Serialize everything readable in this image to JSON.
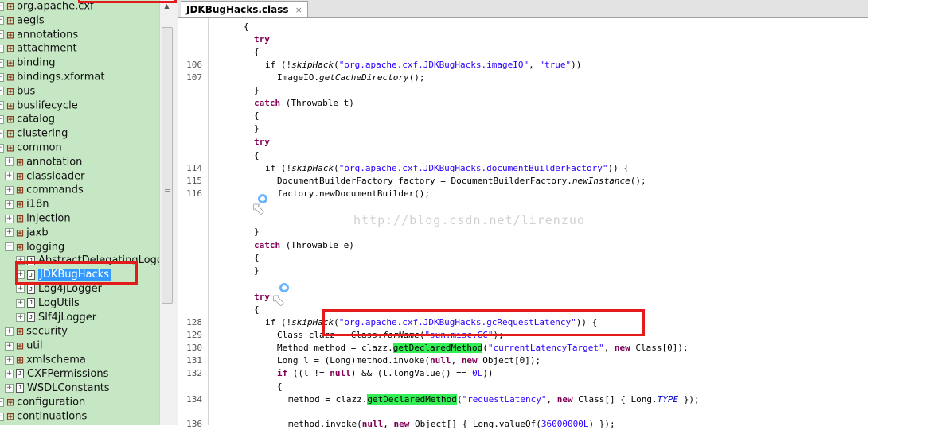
{
  "tree": {
    "items": [
      {
        "label": "org.apache.cxf",
        "kind": "package",
        "expander": "−",
        "level": 0
      },
      {
        "label": "aegis",
        "kind": "package",
        "expander": "+",
        "level": 0
      },
      {
        "label": "annotations",
        "kind": "package",
        "expander": "+",
        "level": 0
      },
      {
        "label": "attachment",
        "kind": "package",
        "expander": "+",
        "level": 0
      },
      {
        "label": "binding",
        "kind": "package",
        "expander": "+",
        "level": 0
      },
      {
        "label": "bindings.xformat",
        "kind": "package",
        "expander": "+",
        "level": 0
      },
      {
        "label": "bus",
        "kind": "package",
        "expander": "+",
        "level": 0
      },
      {
        "label": "buslifecycle",
        "kind": "package",
        "expander": "+",
        "level": 0
      },
      {
        "label": "catalog",
        "kind": "package",
        "expander": "+",
        "level": 0
      },
      {
        "label": "clustering",
        "kind": "package",
        "expander": "+",
        "level": 0
      },
      {
        "label": "common",
        "kind": "package",
        "expander": "−",
        "level": 0
      },
      {
        "label": "annotation",
        "kind": "package",
        "expander": "+",
        "level": 1
      },
      {
        "label": "classloader",
        "kind": "package",
        "expander": "+",
        "level": 1
      },
      {
        "label": "commands",
        "kind": "package",
        "expander": "+",
        "level": 1
      },
      {
        "label": "i18n",
        "kind": "package",
        "expander": "+",
        "level": 1
      },
      {
        "label": "injection",
        "kind": "package",
        "expander": "+",
        "level": 1
      },
      {
        "label": "jaxb",
        "kind": "package",
        "expander": "+",
        "level": 1
      },
      {
        "label": "logging",
        "kind": "package",
        "expander": "−",
        "level": 1
      },
      {
        "label": "AbstractDelegatingLogg",
        "kind": "class",
        "expander": "+",
        "level": 2
      },
      {
        "label": "JDKBugHacks",
        "kind": "class",
        "expander": "+",
        "level": 2,
        "selected": true
      },
      {
        "label": "Log4jLogger",
        "kind": "class",
        "expander": "+",
        "level": 2
      },
      {
        "label": "LogUtils",
        "kind": "class",
        "expander": "+",
        "level": 2
      },
      {
        "label": "Slf4jLogger",
        "kind": "class",
        "expander": "+",
        "level": 2
      },
      {
        "label": "security",
        "kind": "package",
        "expander": "+",
        "level": 1
      },
      {
        "label": "util",
        "kind": "package",
        "expander": "+",
        "level": 1
      },
      {
        "label": "xmlschema",
        "kind": "package",
        "expander": "+",
        "level": 1
      },
      {
        "label": "CXFPermissions",
        "kind": "class",
        "expander": "+",
        "level": 1
      },
      {
        "label": "WSDLConstants",
        "kind": "class",
        "expander": "+",
        "level": 1
      },
      {
        "label": "configuration",
        "kind": "package",
        "expander": "+",
        "level": 0
      },
      {
        "label": "continuations",
        "kind": "package",
        "expander": "+",
        "level": 0
      }
    ],
    "package_icon": "package-icon",
    "class_icon": "class-file-icon",
    "class_glyph": "J"
  },
  "editor": {
    "tab_title": "JDKBugHacks.class",
    "tab_close": "×",
    "watermark": "http://blog.csdn.net/lirenzuo",
    "line_numbers": [
      "106",
      "107",
      "114",
      "115",
      "116",
      "128",
      "129",
      "130",
      "131",
      "132",
      "134",
      "136"
    ],
    "code": {
      "l1": "{",
      "l2_try": "try",
      "l3": "{",
      "l4_a": "if (!",
      "l4_m": "skipHack",
      "l4_b": "(",
      "l4_s1": "\"org.apache.cxf.JDKBugHacks.imageIO\"",
      "l4_c": ", ",
      "l4_s2": "\"true\"",
      "l4_d": "))",
      "l5_a": "ImageIO.",
      "l5_m": "getCacheDirectory",
      "l5_b": "();",
      "l6": "}",
      "l7_kw": "catch",
      "l7_rest": " (Throwable t)",
      "l8": "{",
      "l9": "}",
      "l10_try": "try",
      "l11": "{",
      "l12_a": "if (!",
      "l12_m": "skipHack",
      "l12_b": "(",
      "l12_s": "\"org.apache.cxf.JDKBugHacks.documentBuilderFactory\"",
      "l12_c": ")) {",
      "l13_a": "DocumentBuilderFactory factory = DocumentBuilderFactory.",
      "l13_m": "newInstance",
      "l13_b": "();",
      "l14": "factory.newDocumentBuilder();",
      "l15": "}",
      "l16_kw": "catch",
      "l16_rest": " (Throwable e)",
      "l17": "{",
      "l18": "}",
      "l19_try": "try",
      "l20": "{",
      "l21_a": "if (!",
      "l21_m": "skipHack",
      "l21_b": "(",
      "l21_s": "\"org.apache.cxf.JDKBugHacks.gcRequestLatency\"",
      "l21_c": ")) {",
      "l22_a": "Class clazz = Class.",
      "l22_m": "forName",
      "l22_b": "(",
      "l22_s": "\"sun.misc.GC\"",
      "l22_c": ");",
      "l23_a": "Method method = clazz.",
      "l23_h": "getDeclaredMethod",
      "l23_b": "(",
      "l23_s": "\"currentLatencyTarget\"",
      "l23_c": ", ",
      "l23_kw": "new",
      "l23_d": " Class[0]);",
      "l24_a": "Long l = (Long)method.invoke(",
      "l24_kw1": "null",
      "l24_b": ", ",
      "l24_kw2": "new",
      "l24_c": " Object[0]);",
      "l25_kw": "if",
      "l25_a": " ((l != ",
      "l25_kw2": "null",
      "l25_b": ") && (l.longValue() == ",
      "l25_n": "0L",
      "l25_c": "))",
      "l26": "{",
      "l27_a": "method = clazz.",
      "l27_h": "getDeclaredMethod",
      "l27_b": "(",
      "l27_s": "\"requestLatency\"",
      "l27_c": ", ",
      "l27_kw": "new",
      "l27_d": " Class[] { Long.",
      "l27_t": "TYPE",
      "l27_e": " });",
      "l28_a": "method.invoke(",
      "l28_kw1": "null",
      "l28_b": ", ",
      "l28_kw2": "new",
      "l28_c": " Object[] { Long.valueOf(",
      "l28_n": "36000000L",
      "l28_d": ") });"
    }
  },
  "colors": {
    "tree_bg": "#c6e7c4",
    "selection": "#3399ff",
    "highlight": "#33ee55",
    "annotation_red": "#e31b1b",
    "keyword": "#7f0055",
    "string": "#2a00ff"
  }
}
